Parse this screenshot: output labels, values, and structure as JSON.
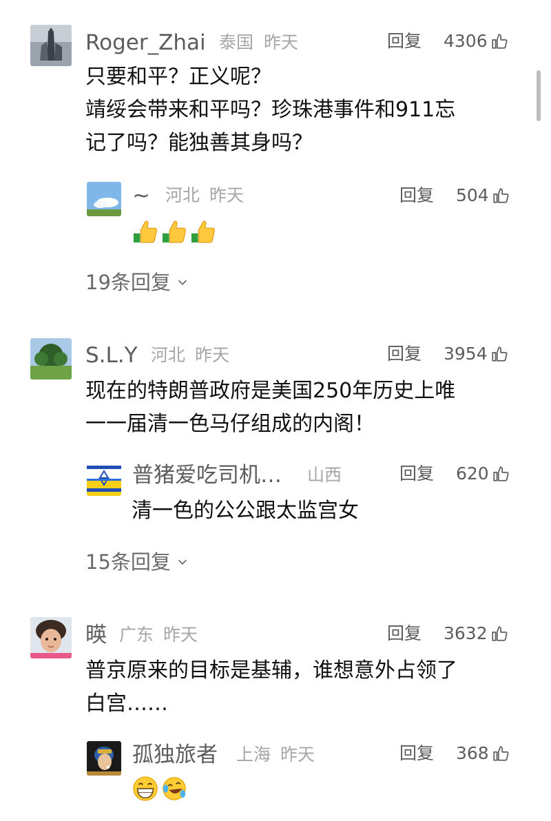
{
  "comments": [
    {
      "author": "Roger_Zhai",
      "region": "泰国",
      "time": "昨天",
      "reply_label": "回复",
      "likes": "4306",
      "text": "只要和平？正义呢？\n靖绥会带来和平吗？珍珠港事件和911忘\n记了吗？能独善其身吗？",
      "top_reply": {
        "author": "~",
        "region": "河北",
        "time": "昨天",
        "reply_label": "回复",
        "likes": "504",
        "emoji": [
          "thumbs-up",
          "thumbs-up",
          "thumbs-up"
        ]
      },
      "more_replies": "19条回复"
    },
    {
      "author": "S.L.Y",
      "region": "河北",
      "time": "昨天",
      "reply_label": "回复",
      "likes": "3954",
      "text": "现在的特朗普政府是美国250年历史上唯\n一一届清一色马仔组成的内阁！",
      "top_reply": {
        "author": "普猪爱吃司机…",
        "region": "山西",
        "time": "",
        "reply_label": "回复",
        "likes": "620",
        "text": "清一色的公公跟太监宫女"
      },
      "more_replies": "15条回复"
    },
    {
      "author": "暎",
      "region": "广东",
      "time": "昨天",
      "reply_label": "回复",
      "likes": "3632",
      "text": "普京原来的目标是基辅，谁想意外占领了\n白宫……",
      "top_reply": {
        "author": "孤独旅者",
        "region": "上海",
        "time": "昨天",
        "reply_label": "回复",
        "likes": "368",
        "emoji": [
          "grin",
          "laugh-cry"
        ]
      }
    }
  ],
  "colors": {
    "name": "#5c5c5c",
    "meta": "#a6a6a6",
    "text": "#111111",
    "more": "#6a6a6a"
  }
}
